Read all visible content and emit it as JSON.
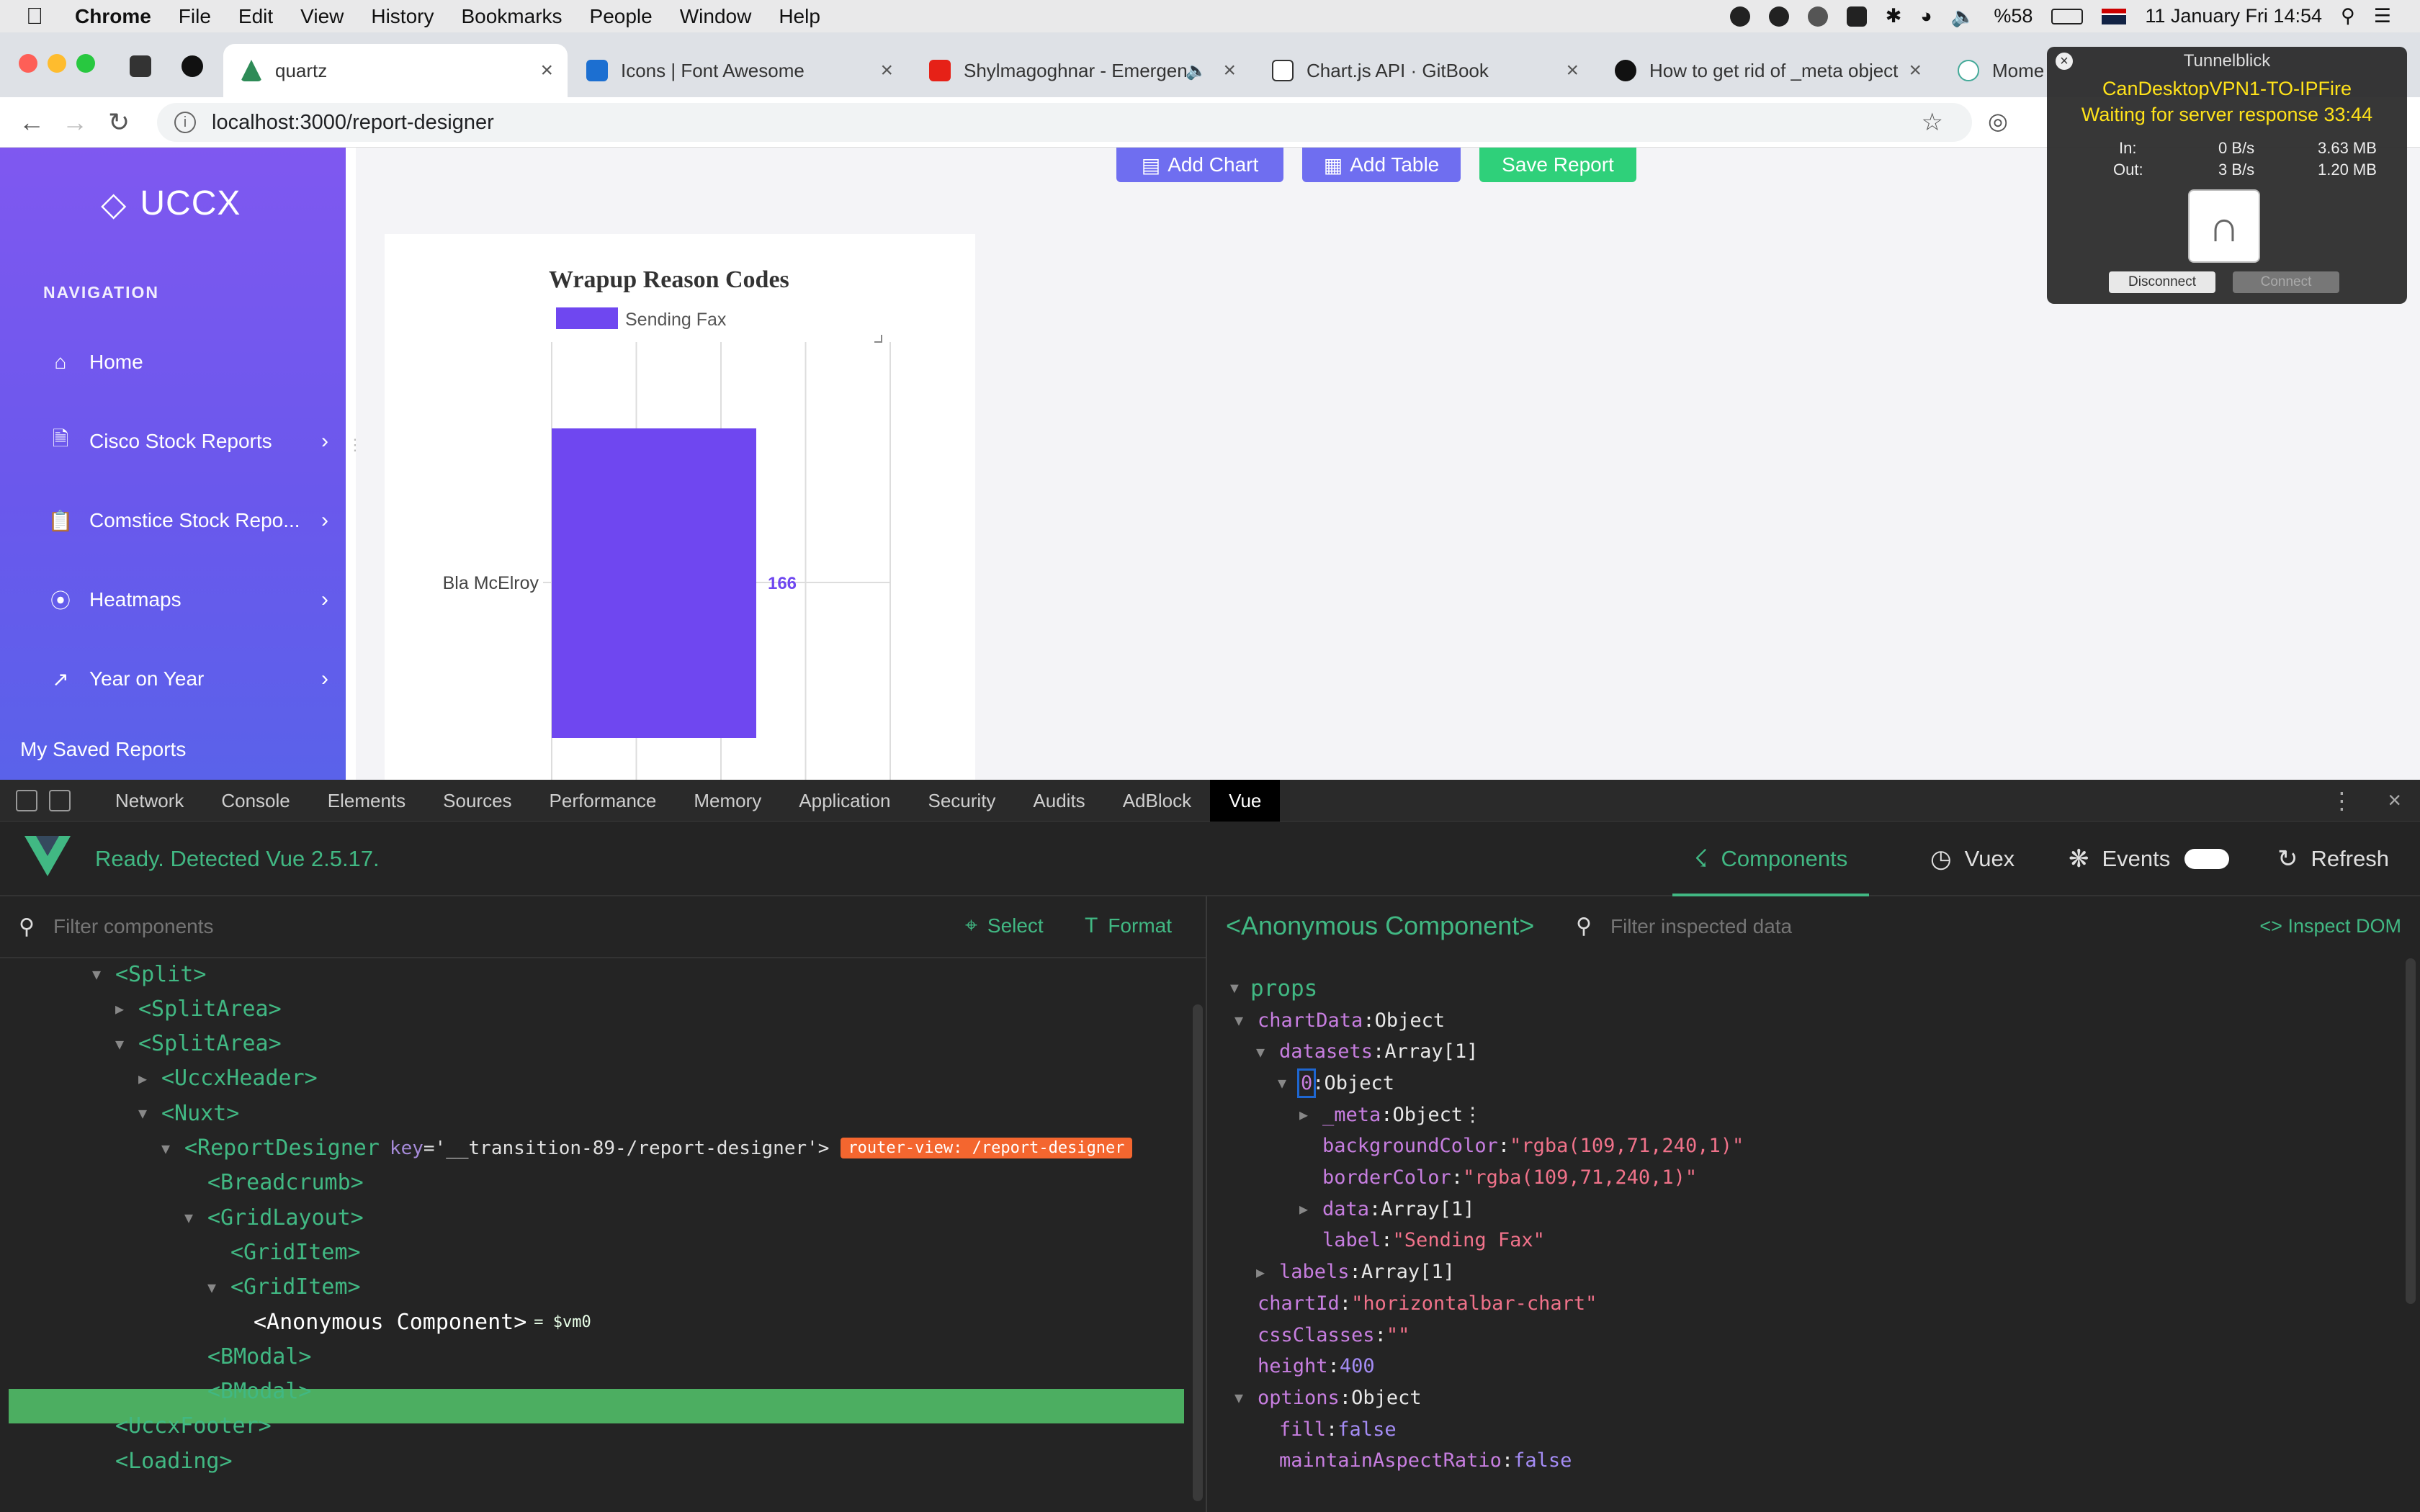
{
  "menubar": {
    "app": "Chrome",
    "items": [
      "File",
      "Edit",
      "View",
      "History",
      "Bookmarks",
      "People",
      "Window",
      "Help"
    ],
    "battery": "%58",
    "datetime": "11 January Fri  14:54"
  },
  "tabs": [
    {
      "label": "quartz",
      "icon": "quartz-logo-icon"
    },
    {
      "label": "Icons | Font Awesome",
      "icon": "font-awesome-flag-icon"
    },
    {
      "label": "Shylmagoghnar - Emergen",
      "icon": "youtube-icon"
    },
    {
      "label": "Chart.js API · GitBook",
      "icon": "gitbook-icon"
    },
    {
      "label": "How to get rid of _meta object",
      "icon": "github-icon"
    },
    {
      "label": "Mome",
      "icon": "momentjs-icon"
    }
  ],
  "address": {
    "url": "localhost:3000/report-designer"
  },
  "sidebar": {
    "brand": "UCCX",
    "nav_title": "NAVIGATION",
    "items": [
      {
        "label": "Home",
        "icon": "home-icon",
        "chevron": false
      },
      {
        "label": "Cisco Stock Reports",
        "icon": "document-icon",
        "chevron": true
      },
      {
        "label": "Comstice Stock Repo...",
        "icon": "clipboard-icon",
        "chevron": true
      },
      {
        "label": "Heatmaps",
        "icon": "compass-icon",
        "chevron": true
      },
      {
        "label": "Year on Year",
        "icon": "trend-icon",
        "chevron": true
      }
    ],
    "saved": "My Saved Reports"
  },
  "toolbar": {
    "add_chart": "Add Chart",
    "add_table": "Add Table",
    "save_report": "Save Report",
    "colors": {
      "add": "#6f6ef0",
      "save": "#2fd07a"
    }
  },
  "chart_data": {
    "type": "bar",
    "orientation": "horizontal",
    "title": "Wrapup Reason Codes",
    "categories": [
      "Bla McElroy"
    ],
    "series": [
      {
        "name": "Sending Fax",
        "values": [
          166
        ],
        "color": "#6f47f0"
      }
    ],
    "data_labels": [
      "166"
    ],
    "legend": "top-left",
    "grid": true
  },
  "tunnelblick": {
    "title": "Tunnelblick",
    "connection": "CanDesktopVPN1-TO-IPFire",
    "status": "Waiting for server response 33:44",
    "in_label": "In:",
    "in_rate": "0 B/s",
    "in_total": "3.63 MB",
    "out_label": "Out:",
    "out_rate": "3 B/s",
    "out_total": "1.20 MB",
    "disconnect": "Disconnect",
    "connect": "Connect"
  },
  "devtools": {
    "tabs": [
      "Network",
      "Console",
      "Elements",
      "Sources",
      "Performance",
      "Memory",
      "Application",
      "Security",
      "Audits",
      "AdBlock",
      "Vue"
    ],
    "active_tab": "Vue"
  },
  "vue": {
    "ready": "Ready. Detected Vue 2.5.17.",
    "tabs": {
      "components": "Components",
      "vuex": "Vuex",
      "events": "Events",
      "refresh": "Refresh"
    },
    "filter_components_placeholder": "Filter components",
    "select": "Select",
    "format": "Format",
    "tree": [
      {
        "indent": 0,
        "tri": "open",
        "tag": "<Split>"
      },
      {
        "indent": 1,
        "tri": "closed",
        "tag": "<SplitArea>"
      },
      {
        "indent": 1,
        "tri": "open",
        "tag": "<SplitArea>"
      },
      {
        "indent": 2,
        "tri": "closed",
        "tag": "<UccxHeader>"
      },
      {
        "indent": 2,
        "tri": "open",
        "tag": "<Nuxt>"
      },
      {
        "indent": 3,
        "tri": "open",
        "tag": "<ReportDesigner",
        "attr_key": "key",
        "attr_val": "='__transition-89-/report-designer'>",
        "badge": "router-view: /report-designer"
      },
      {
        "indent": 4,
        "tri": "none",
        "tag": "<Breadcrumb>"
      },
      {
        "indent": 4,
        "tri": "open",
        "tag": "<GridLayout>"
      },
      {
        "indent": 5,
        "tri": "none",
        "tag": "<GridItem>"
      },
      {
        "indent": 5,
        "tri": "open",
        "tag": "<GridItem>"
      },
      {
        "indent": 6,
        "tri": "none",
        "tag": "<Anonymous Component>",
        "suffix": "= $vm0",
        "selected": true
      },
      {
        "indent": 4,
        "tri": "none",
        "tag": "<BModal>"
      },
      {
        "indent": 4,
        "tri": "none",
        "tag": "<BModal>"
      },
      {
        "indent": 0,
        "tri": "none",
        "tag": "<UccxFooter>"
      },
      {
        "indent": 0,
        "tri": "none",
        "tag": "<Loading>"
      }
    ],
    "inspector": {
      "title": "<Anonymous Component>",
      "filter_placeholder": "Filter inspected data",
      "inspect_dom": "Inspect DOM",
      "section": "props",
      "rows": [
        {
          "indent": 0,
          "tri": "open",
          "key": "chartData",
          "type": "Object"
        },
        {
          "indent": 1,
          "tri": "open",
          "key": "datasets",
          "type": "Array[1]"
        },
        {
          "indent": 2,
          "tri": "open",
          "key": "0",
          "type": "Object"
        },
        {
          "indent": 3,
          "tri": "closed",
          "key": "_meta",
          "type": "Object"
        },
        {
          "indent": 3,
          "tri": "none",
          "key": "backgroundColor",
          "str": "\"rgba(109,71,240,1)\""
        },
        {
          "indent": 3,
          "tri": "none",
          "key": "borderColor",
          "str": "\"rgba(109,71,240,1)\""
        },
        {
          "indent": 3,
          "tri": "closed",
          "key": "data",
          "type": "Array[1]"
        },
        {
          "indent": 3,
          "tri": "none",
          "key": "label",
          "str": "\"Sending Fax\""
        },
        {
          "indent": 1,
          "tri": "closed",
          "key": "labels",
          "type": "Array[1]"
        },
        {
          "indent": 0,
          "tri": "none",
          "key": "chartId",
          "str": "\"horizontalbar-chart\""
        },
        {
          "indent": 0,
          "tri": "none",
          "key": "cssClasses",
          "str": "\"\""
        },
        {
          "indent": 0,
          "tri": "none",
          "key": "height",
          "num": "400"
        },
        {
          "indent": 0,
          "tri": "open",
          "key": "options",
          "type": "Object"
        },
        {
          "indent": 1,
          "tri": "none",
          "key": "fill",
          "bool": "false"
        },
        {
          "indent": 1,
          "tri": "none",
          "key": "maintainAspectRatio",
          "bool": "false"
        }
      ]
    }
  }
}
